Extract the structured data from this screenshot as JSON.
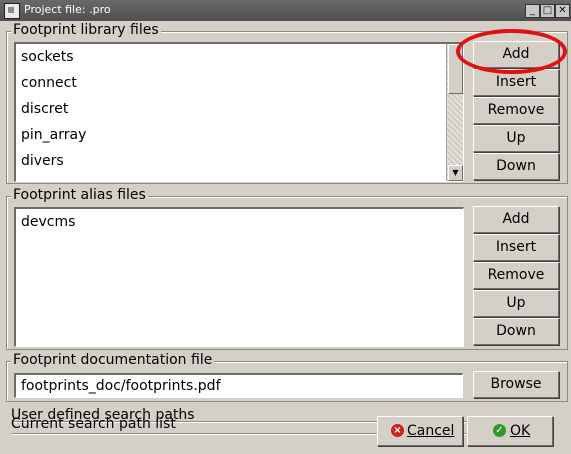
{
  "window": {
    "title": "Project file: .pro"
  },
  "titlebar": {
    "min_glyph": "_",
    "max_glyph": "□",
    "close_glyph": "✕"
  },
  "library_group": {
    "title": "Footprint library files",
    "items": [
      "sockets",
      "connect",
      "discret",
      "pin_array",
      "divers"
    ],
    "buttons": [
      "Add",
      "Insert",
      "Remove",
      "Up",
      "Down"
    ]
  },
  "alias_group": {
    "title": "Footprint alias files",
    "items": [
      "devcms"
    ],
    "buttons": [
      "Add",
      "Insert",
      "Remove",
      "Up",
      "Down"
    ]
  },
  "doc_group": {
    "title": "Footprint documentation file",
    "value": "footprints_doc/footprints.pdf",
    "browse_label": "Browse"
  },
  "search": {
    "user_paths_title": "User defined search paths",
    "current_list_title": "Current search path list"
  },
  "dialog_buttons": {
    "cancel": "Cancel",
    "ok": "OK"
  },
  "annotation": {
    "highlight_color": "#e31010"
  },
  "icons": {
    "cancel": "cancel-icon",
    "ok": "ok-icon",
    "scroll_down": "arrow-down-icon"
  }
}
